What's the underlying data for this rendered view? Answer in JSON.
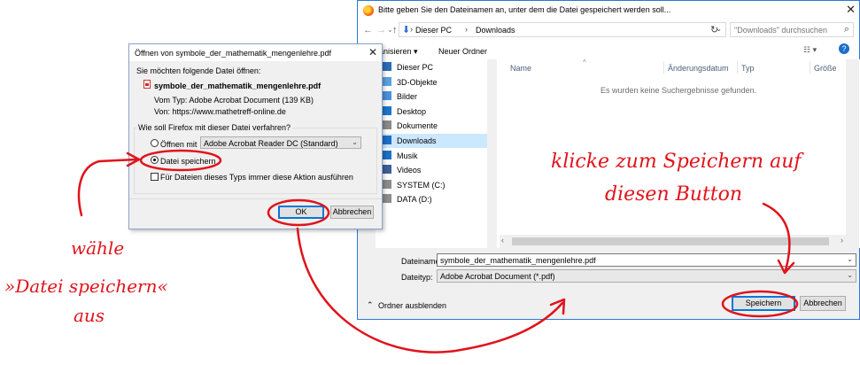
{
  "save_dialog": {
    "title": "Bitte geben Sie den Dateinamen an, unter dem die Datei gespeichert werden soll...",
    "breadcrumb": [
      "Dieser PC",
      "Downloads"
    ],
    "search_placeholder": "\"Downloads\" durchsuchen",
    "toolbar": {
      "organize": "anisieren ▾",
      "new_folder": "Neuer Ordner"
    },
    "nav_items": [
      {
        "label": "Dieser PC",
        "icon": "computer-icon"
      },
      {
        "label": "3D-Objekte",
        "icon": "cube-icon"
      },
      {
        "label": "Bilder",
        "icon": "pictures-icon"
      },
      {
        "label": "Desktop",
        "icon": "desktop-icon"
      },
      {
        "label": "Dokumente",
        "icon": "documents-icon"
      },
      {
        "label": "Downloads",
        "icon": "download-icon",
        "selected": true
      },
      {
        "label": "Musik",
        "icon": "music-icon"
      },
      {
        "label": "Videos",
        "icon": "video-icon"
      },
      {
        "label": "SYSTEM (C:)",
        "icon": "drive-icon"
      },
      {
        "label": "DATA (D:)",
        "icon": "drive-icon"
      }
    ],
    "columns": [
      "Name",
      "Änderungsdatum",
      "Typ",
      "Größe"
    ],
    "empty_message": "Es wurden keine Suchergebnisse gefunden.",
    "filename_label": "Dateiname:",
    "filename_value": "symbole_der_mathematik_mengenlehre.pdf",
    "filetype_label": "Dateityp:",
    "filetype_value": "Adobe Acrobat Document (*.pdf)",
    "hide_folders": "Ordner ausblenden",
    "save_button": "Speichern",
    "cancel_button": "Abbrechen"
  },
  "open_dialog": {
    "title": "Öffnen von symbole_der_mathematik_mengenlehre.pdf",
    "question": "Sie möchten folgende Datei öffnen:",
    "filename": "symbole_der_mathematik_mengenlehre.pdf",
    "type_line": "Vom Typ:  Adobe Acrobat Document (139 KB)",
    "from_line": "Von:  https://www.mathetreff-online.de",
    "group_label": "Wie soll Firefox mit dieser Datei verfahren?",
    "open_with_label": "Öffnen mit",
    "open_with_app": "Adobe Acrobat Reader DC  (Standard)",
    "save_file_label": "Datei speichern",
    "always_label": "Für Dateien dieses Typs immer diese Aktion ausführen",
    "ok_button": "OK",
    "cancel_button": "Abbrechen"
  },
  "annotations": {
    "right_line1": "klicke zum Speichern auf",
    "right_line2": "diesen Button",
    "left_line1": "wähle",
    "left_line2": "»Datei speichern«",
    "left_line3": "aus",
    "color": "#e0131b"
  }
}
